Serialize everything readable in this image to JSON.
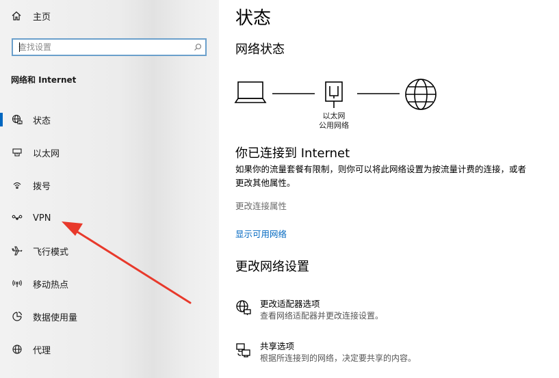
{
  "sidebar": {
    "home_label": "主页",
    "search": {
      "placeholder": "查找设置",
      "value": ""
    },
    "section_title": "网络和 Internet",
    "items": [
      {
        "label": "状态",
        "icon": "globe-status-icon",
        "active": true
      },
      {
        "label": "以太网",
        "icon": "ethernet-icon"
      },
      {
        "label": "拨号",
        "icon": "dialup-icon"
      },
      {
        "label": "VPN",
        "icon": "vpn-icon"
      },
      {
        "label": "飞行模式",
        "icon": "airplane-icon"
      },
      {
        "label": "移动热点",
        "icon": "hotspot-icon"
      },
      {
        "label": "数据使用量",
        "icon": "data-usage-icon"
      },
      {
        "label": "代理",
        "icon": "proxy-globe-icon"
      }
    ]
  },
  "main": {
    "title": "状态",
    "network_status_title": "网络状态",
    "diagram": {
      "adapter_name": "以太网",
      "network_type": "公用网络"
    },
    "connected_title": "你已连接到 Internet",
    "connected_desc": "如果你的流量套餐有限制，则你可以将此网络设置为按流量计费的连接，或者更改其他属性。",
    "change_properties_link": "更改连接属性",
    "show_networks_link": "显示可用网络",
    "change_settings_title": "更改网络设置",
    "options": [
      {
        "title": "更改适配器选项",
        "desc": "查看网络适配器并更改连接设置。",
        "icon": "adapter-globe-icon"
      },
      {
        "title": "共享选项",
        "desc": "根据所连接到的网络，决定要共享的内容。",
        "icon": "sharing-icon"
      }
    ]
  },
  "colors": {
    "accent": "#0067c0",
    "annotation_arrow": "#e8392b"
  }
}
